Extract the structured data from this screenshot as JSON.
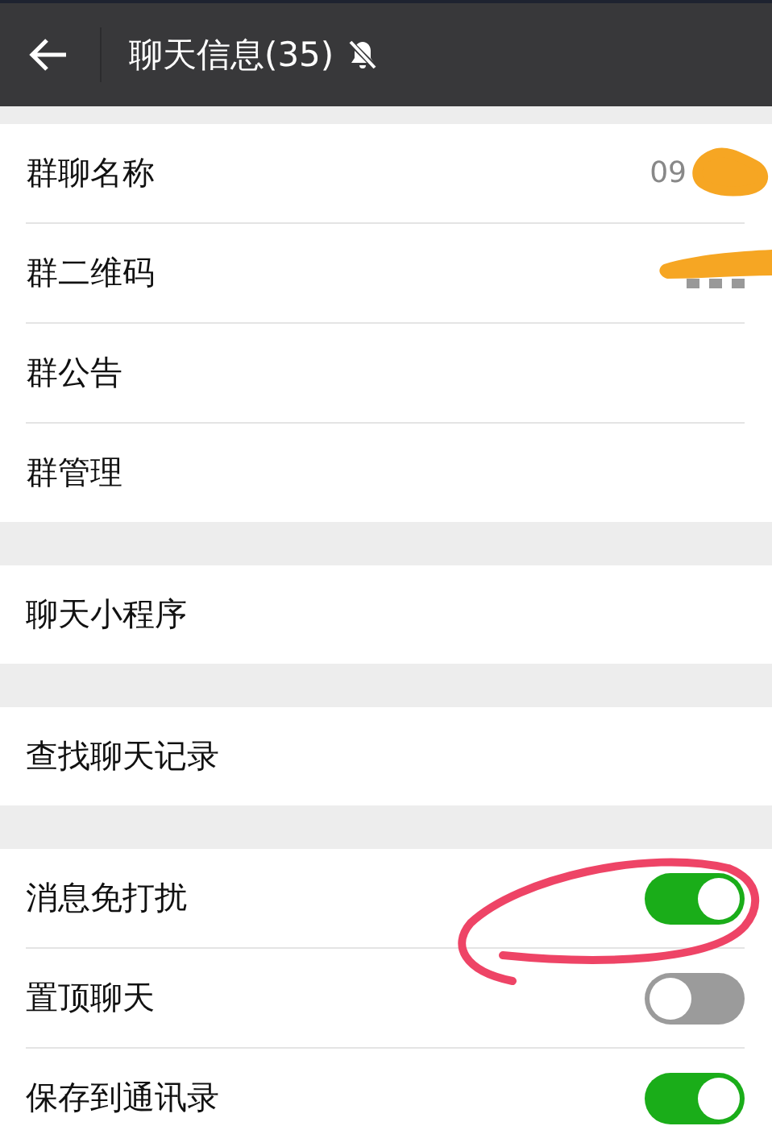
{
  "header": {
    "title": "聊天信息(35)",
    "muted": true
  },
  "sections": [
    {
      "rows": [
        {
          "kind": "value",
          "label": "群聊名称",
          "value": "09"
        },
        {
          "kind": "qr",
          "label": "群二维码"
        },
        {
          "kind": "plain",
          "label": "群公告"
        },
        {
          "kind": "plain",
          "label": "群管理"
        }
      ]
    },
    {
      "rows": [
        {
          "kind": "plain",
          "label": "聊天小程序"
        }
      ]
    },
    {
      "rows": [
        {
          "kind": "plain",
          "label": "查找聊天记录"
        }
      ]
    },
    {
      "rows": [
        {
          "kind": "toggle",
          "label": "消息免打扰",
          "on": true
        },
        {
          "kind": "toggle",
          "label": "置顶聊天",
          "on": false
        },
        {
          "kind": "toggle",
          "label": "保存到通讯录",
          "on": true
        }
      ]
    }
  ]
}
